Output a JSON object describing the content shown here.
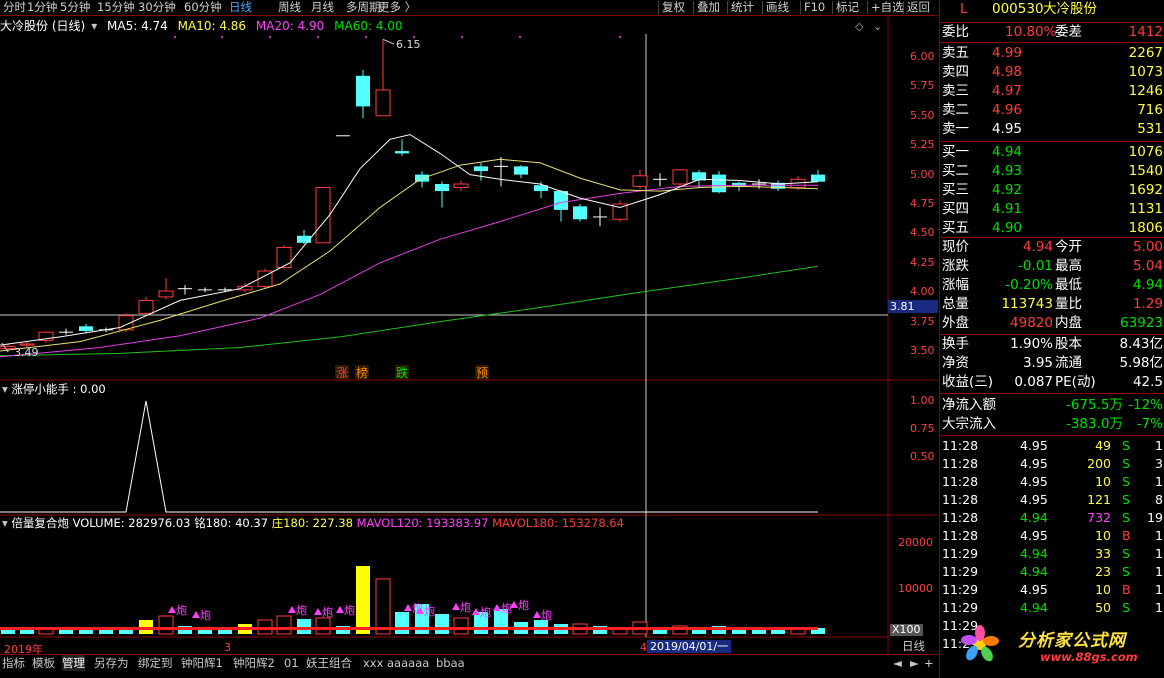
{
  "toolbar": {
    "periods": [
      "分时",
      "1分钟",
      "5分钟",
      "15分钟",
      "30分钟",
      "60分钟",
      "日线",
      "周线",
      "月线",
      "多周期",
      "更多 〉"
    ],
    "active": "日线",
    "right_buttons": [
      "复权",
      "叠加",
      "统计",
      "画线",
      "F10",
      "标记",
      "+自选",
      "返回"
    ]
  },
  "main_panel": {
    "stock_label": "大冷股份 (日线)",
    "ma5": "MA5: 4.74",
    "ma10": "MA10: 4.86",
    "ma20": "MA20: 4.90",
    "ma60": "MA60: 4.00",
    "high_label": "6.15",
    "low_label": "3.49",
    "price_ticks": [
      "6.00",
      "5.75",
      "5.50",
      "5.25",
      "5.00",
      "4.75",
      "4.50",
      "4.25",
      "4.00",
      "3.75",
      "3.50"
    ],
    "current_marker": "3.81",
    "signals": [
      "涨",
      "榜",
      "跌",
      "预"
    ]
  },
  "indicator1": {
    "title": "涨停小能手 : 0.00",
    "ticks": [
      "1.00",
      "0.75",
      "0.50"
    ]
  },
  "indicator2": {
    "title_name": "倍量复合炮",
    "volume": "VOLUME: 282976.03",
    "v180": "铭180: 40.37",
    "z180": "庄180: 227.38",
    "mavol120": "MAVOL120: 193383.97",
    "mavol180": "MAVOL180: 153278.64",
    "ticks": [
      "20000",
      "10000"
    ],
    "unit": "X100",
    "pao": "炮",
    "year_label": "2019年",
    "month_label": "3",
    "marker4": "4",
    "date_label": "2019/04/01/一"
  },
  "bottom_tabs": [
    "指标",
    "模板",
    "管理",
    "另存为",
    "绑定到",
    "钟阳辉1",
    "钟阳辉2",
    "01",
    "妖王组合",
    "xxx",
    "aaaaaa",
    "bbaa"
  ],
  "bottom_active": "管理",
  "bottom_right": "日线",
  "quote": {
    "L": "L",
    "code": "000530",
    "name": "大冷股份",
    "weibi_label": "委比",
    "weibi": "10.80%",
    "weicha_label": "委差",
    "weicha": "1412",
    "sells": [
      {
        "label": "卖五",
        "price": "4.99",
        "vol": "2267"
      },
      {
        "label": "卖四",
        "price": "4.98",
        "vol": "1073"
      },
      {
        "label": "卖三",
        "price": "4.97",
        "vol": "1246"
      },
      {
        "label": "卖二",
        "price": "4.96",
        "vol": "716"
      },
      {
        "label": "卖一",
        "price": "4.95",
        "vol": "531"
      }
    ],
    "buys": [
      {
        "label": "买一",
        "price": "4.94",
        "vol": "1076"
      },
      {
        "label": "买二",
        "price": "4.93",
        "vol": "1540"
      },
      {
        "label": "买三",
        "price": "4.92",
        "vol": "1692"
      },
      {
        "label": "买四",
        "price": "4.91",
        "vol": "1131"
      },
      {
        "label": "买五",
        "price": "4.90",
        "vol": "1806"
      }
    ],
    "stats": [
      {
        "l1": "现价",
        "v1": "4.94",
        "l2": "今开",
        "v2": "5.00"
      },
      {
        "l1": "涨跌",
        "v1": "-0.01",
        "l2": "最高",
        "v2": "5.04"
      },
      {
        "l1": "涨幅",
        "v1": "-0.20%",
        "l2": "最低",
        "v2": "4.94"
      },
      {
        "l1": "总量",
        "v1": "113743",
        "l2": "量比",
        "v2": "1.29"
      },
      {
        "l1": "外盘",
        "v1": "49820",
        "l2": "内盘",
        "v2": "63923"
      }
    ],
    "stats2": [
      {
        "l1": "换手",
        "v1": "1.90%",
        "l2": "股本",
        "v2": "8.43亿"
      },
      {
        "l1": "净资",
        "v1": "3.95",
        "l2": "流通",
        "v2": "5.98亿"
      },
      {
        "l1": "收益(三)",
        "v1": "0.087",
        "l2": "PE(动)",
        "v2": "42.5"
      }
    ],
    "flows": [
      {
        "label": "净流入额",
        "value": "-675.5万",
        "pct": "-12%"
      },
      {
        "label": "大宗流入",
        "value": "-383.0万",
        "pct": "-7%"
      }
    ],
    "ticks": [
      {
        "t": "11:28",
        "p": "4.95",
        "v": "49",
        "s": "S",
        "n": "1"
      },
      {
        "t": "11:28",
        "p": "4.95",
        "v": "200",
        "s": "S",
        "n": "3"
      },
      {
        "t": "11:28",
        "p": "4.95",
        "v": "10",
        "s": "S",
        "n": "1"
      },
      {
        "t": "11:28",
        "p": "4.95",
        "v": "121",
        "s": "S",
        "n": "8"
      },
      {
        "t": "11:28",
        "p": "4.94",
        "v": "732",
        "s": "S",
        "n": "19"
      },
      {
        "t": "11:28",
        "p": "4.95",
        "v": "10",
        "s": "B",
        "n": "1"
      },
      {
        "t": "11:29",
        "p": "4.94",
        "v": "33",
        "s": "S",
        "n": "1"
      },
      {
        "t": "11:29",
        "p": "4.94",
        "v": "23",
        "s": "S",
        "n": "1"
      },
      {
        "t": "11:29",
        "p": "4.95",
        "v": "10",
        "s": "B",
        "n": "1"
      },
      {
        "t": "11:29",
        "p": "4.94",
        "v": "50",
        "s": "S",
        "n": "1"
      },
      {
        "t": "11:29",
        "p": "",
        "v": "",
        "s": "",
        "n": ""
      },
      {
        "t": "11:29",
        "p": "",
        "v": "",
        "s": "",
        "n": ""
      }
    ],
    "watermark_cn": "分析家公式网",
    "watermark_url": "www.88gs.com"
  }
}
